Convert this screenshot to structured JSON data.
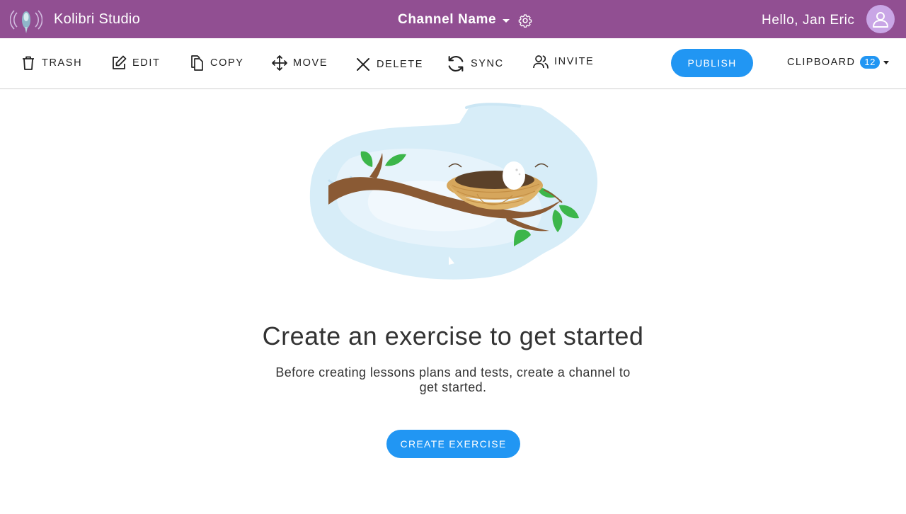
{
  "header": {
    "app_title": "Kolibri Studio",
    "channel_name": "Channel Name",
    "greeting": "Hello, Jan Eric",
    "background_color": "#914f92",
    "logo_icon": "kolibri-logo-icon",
    "settings_icon": "gear-icon",
    "avatar_icon": "user-avatar-icon",
    "avatar_color": "#c9a6e6"
  },
  "toolbar": {
    "trash_label": "TRASH",
    "edit_label": "EDIT",
    "copy_label": "COPY",
    "move_label": "MOVE",
    "delete_label": "DELETE",
    "sync_label": "SYNC",
    "invite_label": "INVITE",
    "publish_label": "PUBLISH",
    "clipboard_label": "CLIPBOARD",
    "clipboard_count": "12",
    "accent_color": "#2196f3"
  },
  "main": {
    "illustration": "bird-nest-on-branch",
    "heading": "Create an exercise to get started",
    "description": "Before creating lessons plans and tests, create a channel to get started.",
    "create_button_label": "CREATE EXERCISE"
  }
}
